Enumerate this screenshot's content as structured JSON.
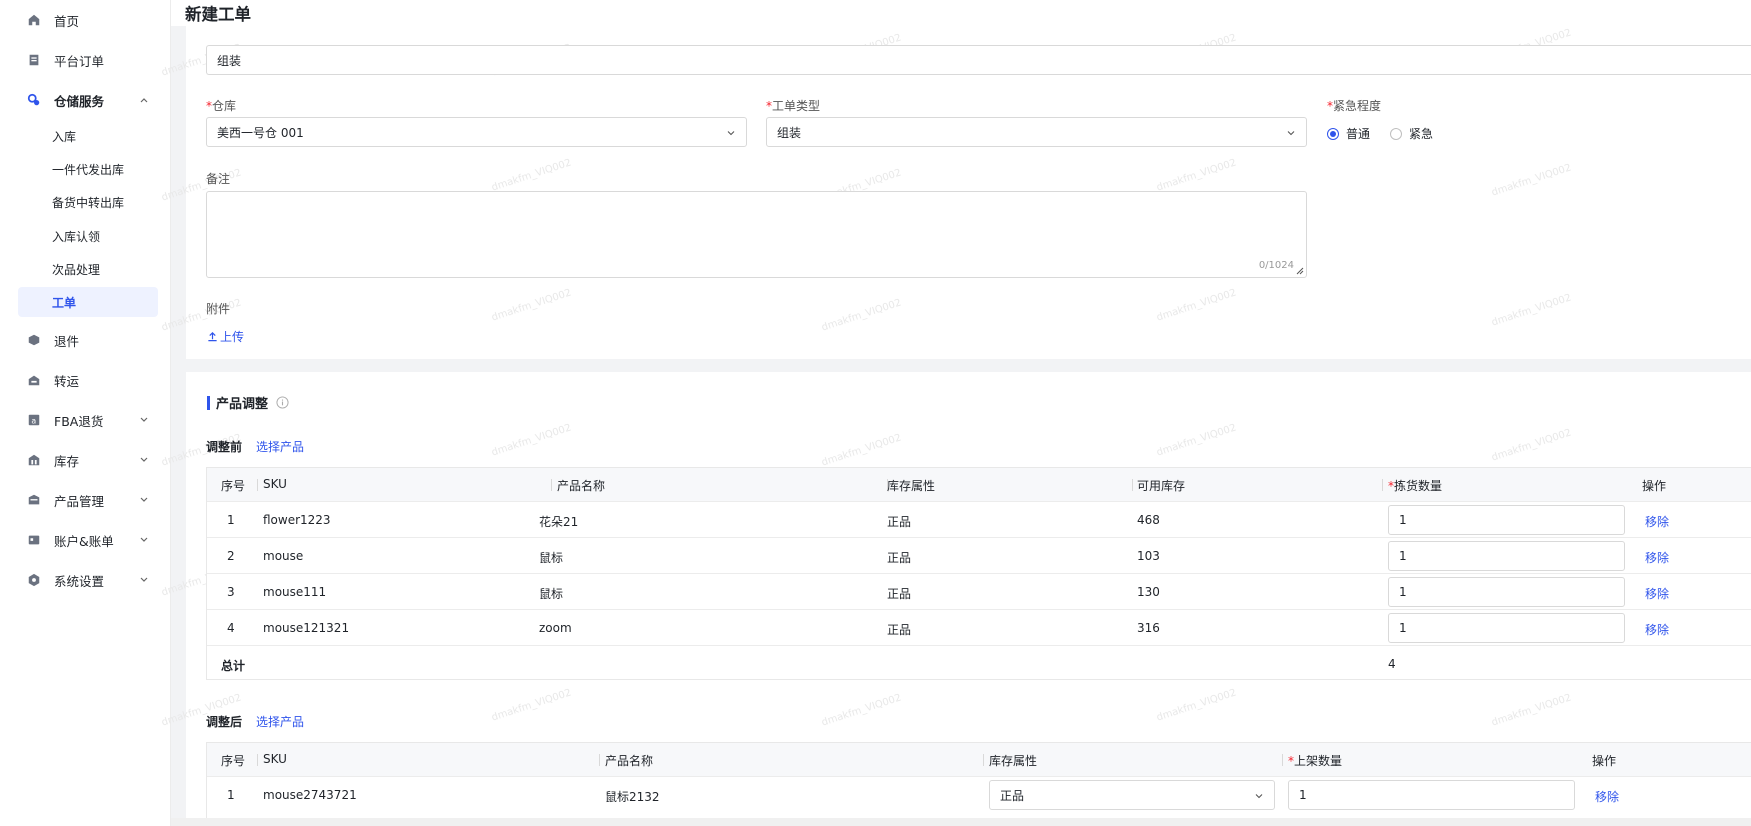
{
  "sidebar": {
    "items": [
      {
        "label": "首页",
        "icon": "home-icon"
      },
      {
        "label": "平台订单",
        "icon": "order-icon"
      },
      {
        "label": "仓储服务",
        "icon": "warehouse-icon"
      },
      {
        "label": "退件",
        "icon": "return-icon"
      },
      {
        "label": "转运",
        "icon": "transfer-icon"
      },
      {
        "label": "FBA退货",
        "icon": "fba-icon"
      },
      {
        "label": "库存",
        "icon": "inventory-icon"
      },
      {
        "label": "产品管理",
        "icon": "product-icon"
      },
      {
        "label": "账户&账单",
        "icon": "account-icon"
      },
      {
        "label": "系统设置",
        "icon": "settings-icon"
      }
    ],
    "sub_items": [
      "入库",
      "一件代发出库",
      "备货中转出库",
      "入库认领",
      "次品处理",
      "工单"
    ],
    "active_sub": "工单"
  },
  "page": {
    "title": "新建工单"
  },
  "form": {
    "top_value": "组装",
    "warehouse_label": "仓库",
    "warehouse_value": "美西一号仓 001",
    "type_label": "工单类型",
    "type_value": "组装",
    "urgency_label": "紧急程度",
    "urgency_options": [
      "普通",
      "紧急"
    ],
    "urgency_selected": "普通",
    "remark_label": "备注",
    "remark_counter": "0/1024",
    "attach_label": "附件",
    "upload_label": "上传"
  },
  "adjust": {
    "section_title": "产品调整",
    "before_title": "调整前",
    "after_title": "调整后",
    "select_product": "选择产品",
    "before_headers": [
      "序号",
      "SKU",
      "产品名称",
      "库存属性",
      "可用库存",
      "拣货数量",
      "操作"
    ],
    "before_rows": [
      {
        "no": "1",
        "sku": "flower1223",
        "name": "花朵21",
        "attr": "正品",
        "stock": "468",
        "qty": "1",
        "action": "移除"
      },
      {
        "no": "2",
        "sku": "mouse",
        "name": "鼠标",
        "attr": "正品",
        "stock": "103",
        "qty": "1",
        "action": "移除"
      },
      {
        "no": "3",
        "sku": "mouse111",
        "name": "鼠标",
        "attr": "正品",
        "stock": "130",
        "qty": "1",
        "action": "移除"
      },
      {
        "no": "4",
        "sku": "mouse121321",
        "name": "zoom",
        "attr": "正品",
        "stock": "316",
        "qty": "1",
        "action": "移除"
      }
    ],
    "total_label": "总计",
    "total_value": "4",
    "after_headers": [
      "序号",
      "SKU",
      "产品名称",
      "库存属性",
      "上架数量",
      "操作"
    ],
    "after_rows": [
      {
        "no": "1",
        "sku": "mouse2743721",
        "name": "鼠标2132",
        "attr": "正品",
        "qty": "1",
        "action": "移除"
      }
    ]
  },
  "watermark": "dmakfm_VIQ002"
}
